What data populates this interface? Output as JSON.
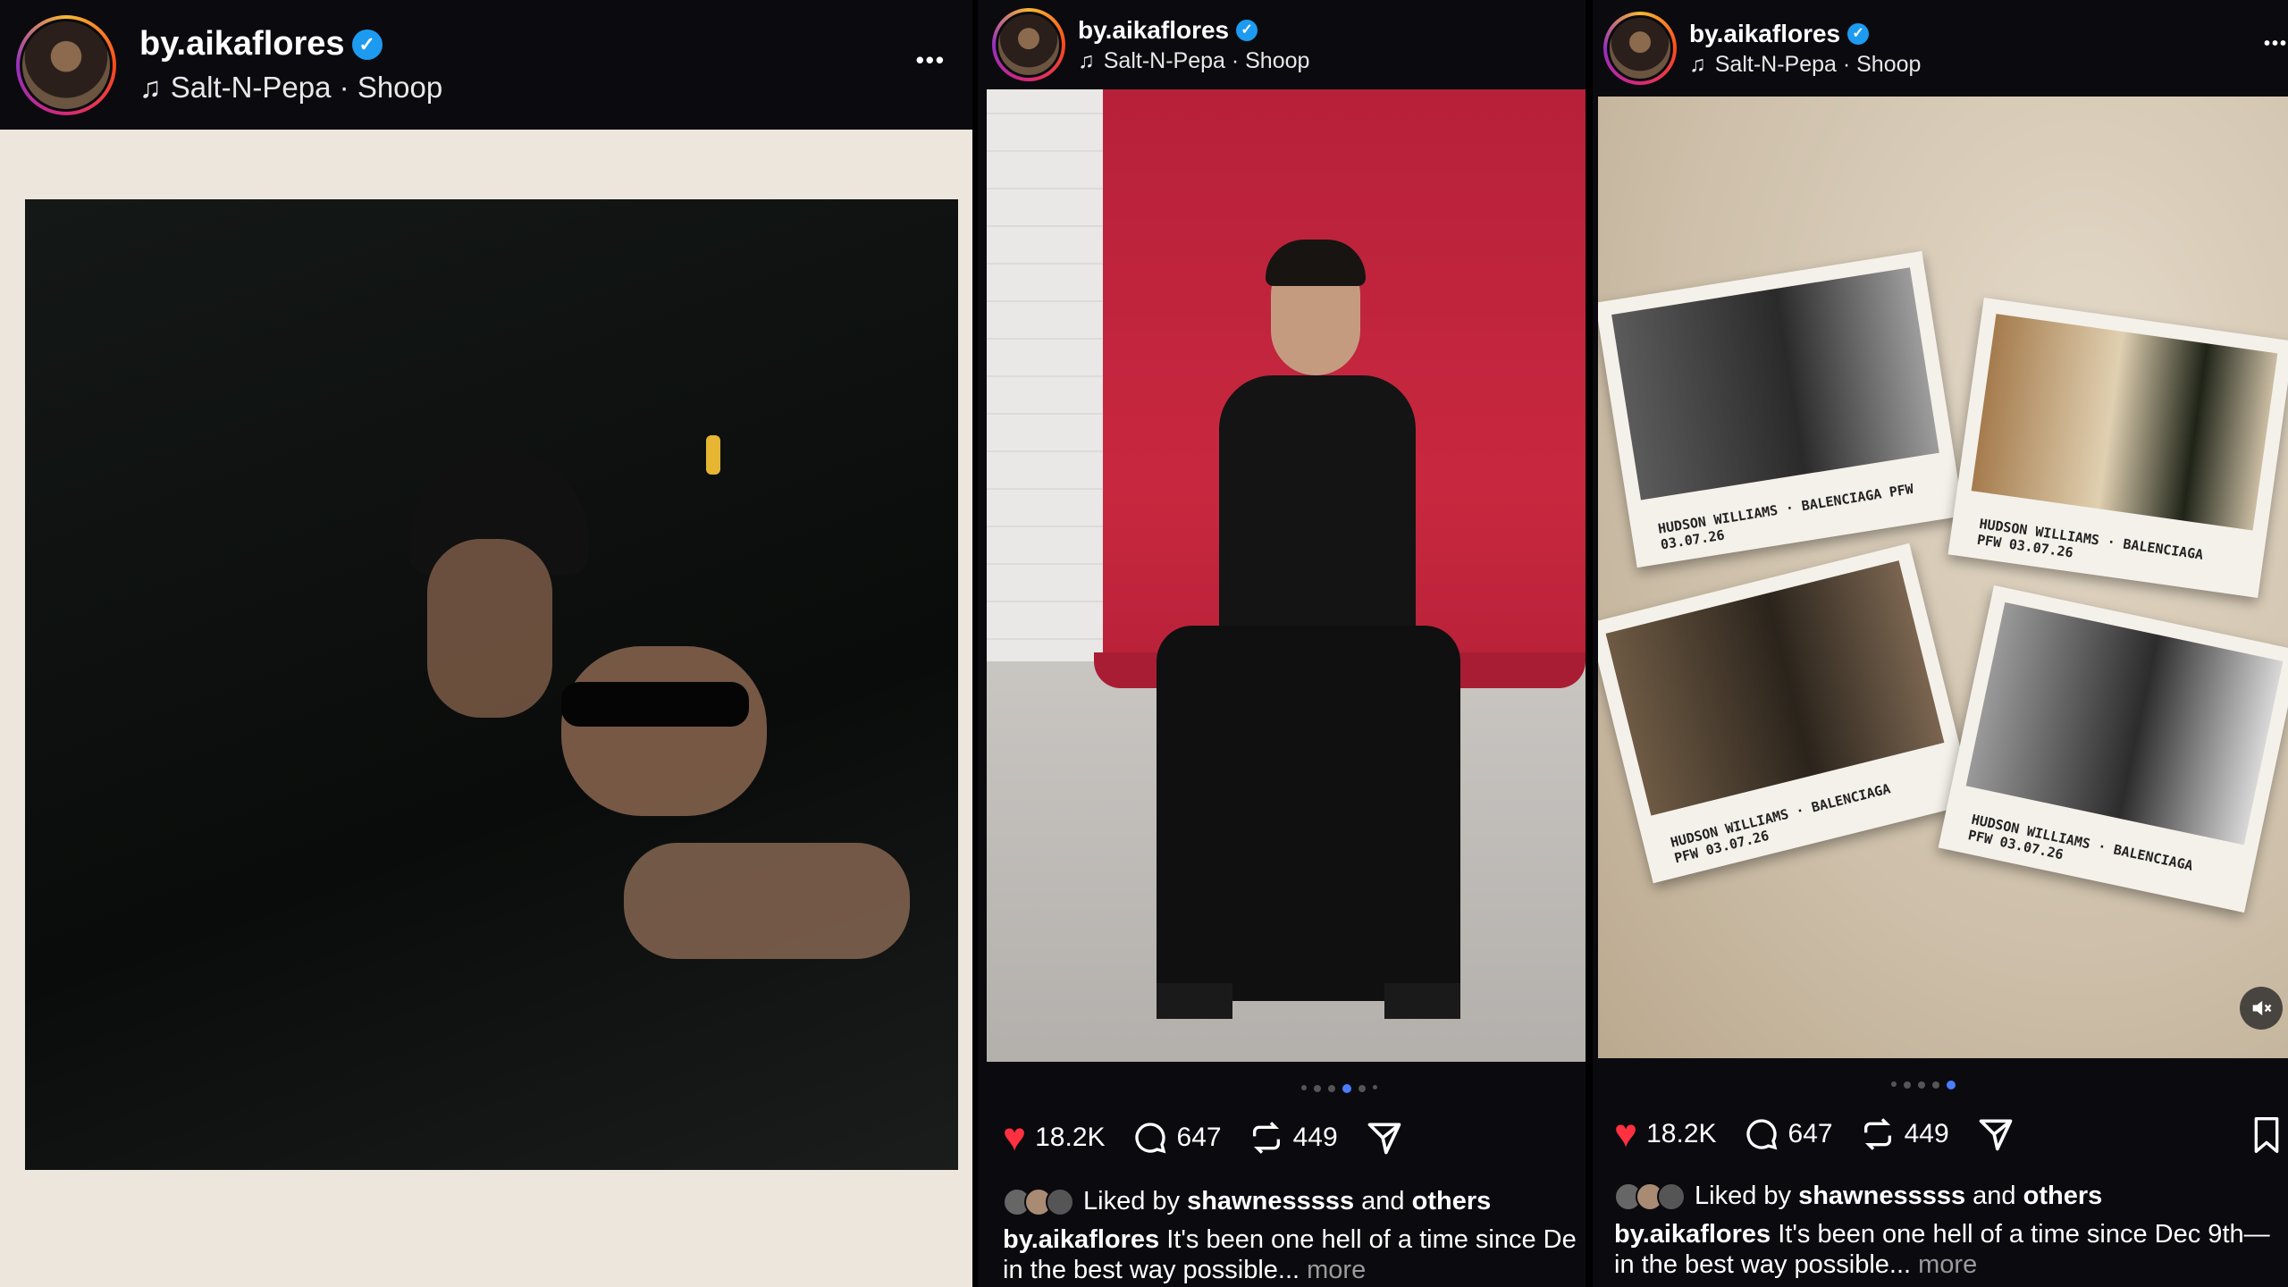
{
  "posts": [
    {
      "username": "by.aikaflores",
      "verified": true,
      "song": "Salt-N-Pepa · Shoop",
      "more_label": "•••"
    },
    {
      "username": "by.aikaflores",
      "verified": true,
      "song": "Salt-N-Pepa · Shoop",
      "carousel": {
        "count": 6,
        "active_index": 3
      },
      "likes": "18.2K",
      "comments": "647",
      "reposts": "449",
      "liked_by_prefix": "Liked by",
      "liked_by_user": "shawnesssss",
      "liked_by_and": "and",
      "liked_by_others": "others",
      "caption_user": "by.aikaflores",
      "caption_text": "It's been one hell of a time since De",
      "caption_line2": "in the best way possible...",
      "more_link": "more"
    },
    {
      "username": "by.aikaflores",
      "verified": true,
      "song": "Salt-N-Pepa · Shoop",
      "more_label": "•••",
      "carousel": {
        "count": 5,
        "active_index": 4
      },
      "likes": "18.2K",
      "comments": "647",
      "reposts": "449",
      "liked_by_prefix": "Liked by",
      "liked_by_user": "shawnesssss",
      "liked_by_and": "and",
      "liked_by_others": "others",
      "caption_user": "by.aikaflores",
      "caption_text": "It's been one hell of a time since Dec 9th—",
      "caption_line2": "in the best way possible...",
      "more_link": "more",
      "polaroid_notes": [
        "HUDSON WILLIAMS · BALENCIAGA PFW\n03.07.26",
        "HUDSON WILLIAMS · BALENCIAGA\nPFW 03.07.26",
        "HUDSON WILLIAMS · BALENCIAGA\nPFW 03.07.26",
        "HUDSON WILLIAMS · BALENCIAGA\nPFW 03.07.26"
      ]
    }
  ],
  "icons": {
    "verified": "verified-check-icon",
    "music": "music-note-icon",
    "like": "heart-icon",
    "comment": "comment-icon",
    "repost": "repost-icon",
    "share": "send-icon",
    "save": "bookmark-icon",
    "mute": "muted-speaker-icon"
  },
  "colors": {
    "like_red": "#ff3040",
    "verified_blue": "#1d9bf0",
    "carousel_active": "#4a7dff",
    "backdrop_red": "#c2273d"
  }
}
